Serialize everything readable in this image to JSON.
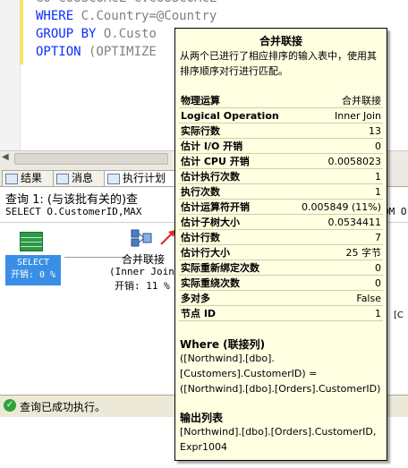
{
  "editor": {
    "line0": "GO COUSCOMCL C.COUSCOMCL",
    "line1_kw": "WHERE",
    "line1_rest": " C.Country=@Country",
    "line2_kw": "GROUP BY",
    "line2_rest": " O.Custo",
    "line3_kw": "OPTION",
    "line3_rest": " (OPTIMIZE"
  },
  "tabs": [
    {
      "label": "结果"
    },
    {
      "label": "消息"
    },
    {
      "label": "执行计划"
    }
  ],
  "results": {
    "query_header": "查询 1: (与该批有关的)查",
    "query_sql": "SELECT O.CustomerID,MAX",
    "query_sql_tail": "OM O",
    "select_node_title": "SELECT",
    "select_node_cost": "开销: 0 %",
    "merge_label": "合并联接",
    "merge_sub": "(Inner Join",
    "merge_cost": "开销: 11 %",
    "side_mark": "[C"
  },
  "status": {
    "text": "查询已成功执行。"
  },
  "tooltip": {
    "title": "合并联接",
    "description": "从两个已进行了相应排序的输入表中，使用其排序顺序对行进行匹配。",
    "rows": [
      {
        "key": "物理运算",
        "value": "合并联接"
      },
      {
        "key": "Logical Operation",
        "value": "Inner Join"
      },
      {
        "key": "实际行数",
        "value": "13"
      },
      {
        "key": "估计 I/O 开销",
        "value": "0"
      },
      {
        "key": "估计 CPU 开销",
        "value": "0.0058023"
      },
      {
        "key": "估计执行次数",
        "value": "1"
      },
      {
        "key": "执行次数",
        "value": "1"
      },
      {
        "key": "估计运算符开销",
        "value": "0.005849 (11%)"
      },
      {
        "key": "估计子树大小",
        "value": "0.0534411"
      },
      {
        "key": "估计行数",
        "value": "7"
      },
      {
        "key": "估计行大小",
        "value": "25 字节"
      },
      {
        "key": "实际重新绑定次数",
        "value": "0"
      },
      {
        "key": "实际重绕次数",
        "value": "0"
      },
      {
        "key": "多对多",
        "value": "False"
      },
      {
        "key": "节点 ID",
        "value": "1"
      }
    ],
    "where_title": "Where (联接列)",
    "where_text": "([Northwind].[dbo].[Customers].CustomerID) = ([Northwind].[dbo].[Orders].CustomerID)",
    "output_title": "输出列表",
    "output_text": "[Northwind].[dbo].[Orders].CustomerID, Expr1004"
  },
  "colors": {
    "keyword": "#0a2cff",
    "tooltip_bg": "#ffffe1",
    "select_node": "#3a8ee6"
  }
}
